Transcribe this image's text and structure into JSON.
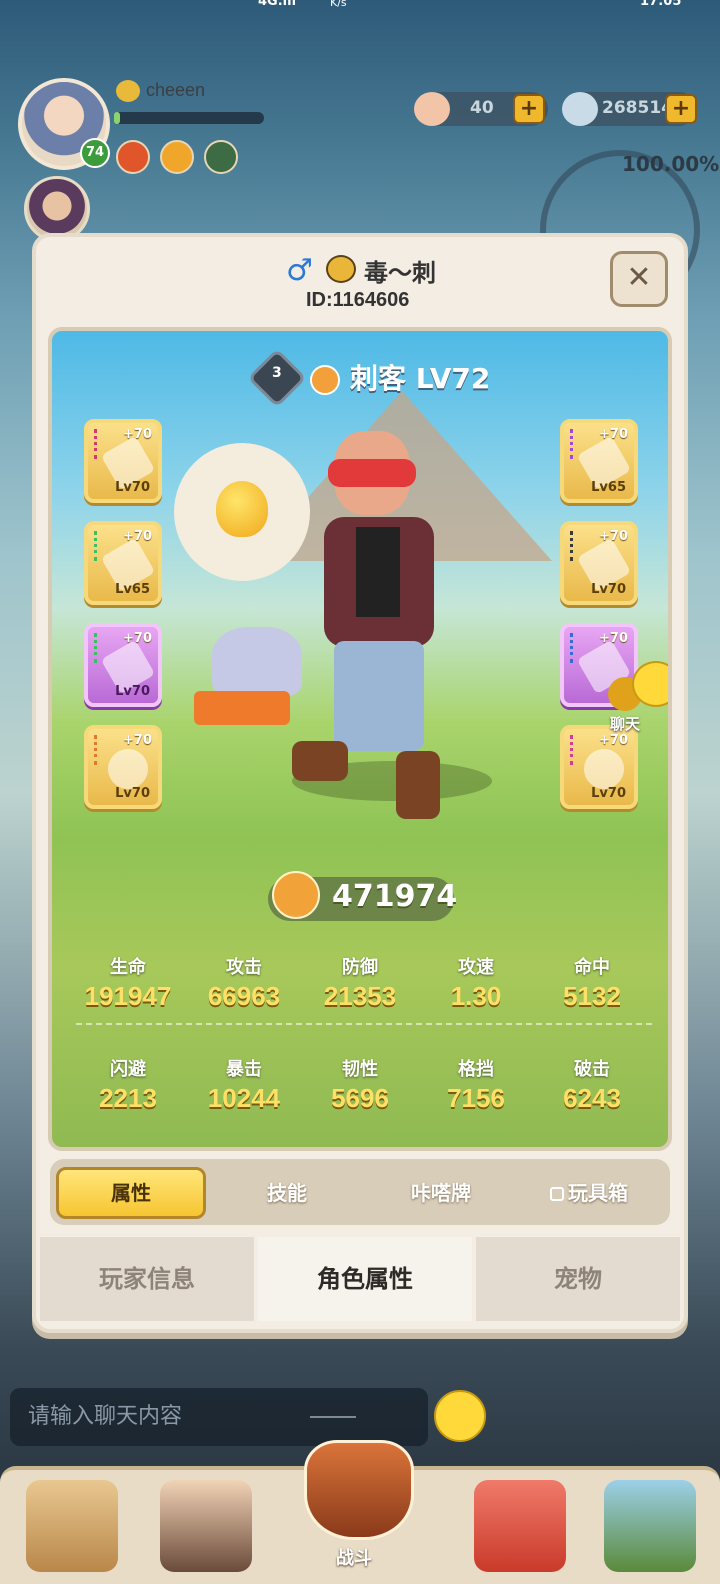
{
  "status_bar": {
    "network": "4G.ıll",
    "speed": "K/s",
    "time": "17:05"
  },
  "hud": {
    "level": "74",
    "username": "cheeen",
    "exp_fraction": 0.04,
    "currency_1": {
      "icon": "shell-icon",
      "value": "40"
    },
    "currency_2": {
      "icon": "gem-icon",
      "value": "268514"
    },
    "percent": "100.00%"
  },
  "panel": {
    "player_name": "毒～刺",
    "player_id": "ID:1164606",
    "gender_icon": "♂",
    "close": "✕",
    "rank": "3",
    "class_title": "刺客 LV72",
    "equipment_left": [
      {
        "plus": "+70",
        "lv": "Lv70",
        "rarity": "gold"
      },
      {
        "plus": "+70",
        "lv": "Lv65",
        "rarity": "gold"
      },
      {
        "plus": "+70",
        "lv": "Lv70",
        "rarity": "purple"
      },
      {
        "plus": "+70",
        "lv": "Lv70",
        "rarity": "gold"
      }
    ],
    "equipment_right": [
      {
        "plus": "+70",
        "lv": "Lv65",
        "rarity": "gold"
      },
      {
        "plus": "+70",
        "lv": "Lv70",
        "rarity": "gold"
      },
      {
        "plus": "+70",
        "lv": "",
        "rarity": "purple"
      },
      {
        "plus": "+70",
        "lv": "Lv70",
        "rarity": "gold"
      }
    ],
    "chat_label": "聊天",
    "power": "471974",
    "stats_row1": [
      {
        "label": "生命",
        "value": "191947"
      },
      {
        "label": "攻击",
        "value": "66963"
      },
      {
        "label": "防御",
        "value": "21353"
      },
      {
        "label": "攻速",
        "value": "1.30"
      },
      {
        "label": "命中",
        "value": "5132"
      }
    ],
    "stats_row2": [
      {
        "label": "闪避",
        "value": "2213"
      },
      {
        "label": "暴击",
        "value": "10244"
      },
      {
        "label": "韧性",
        "value": "5696"
      },
      {
        "label": "格挡",
        "value": "7156"
      },
      {
        "label": "破击",
        "value": "6243"
      }
    ],
    "sub_tabs": [
      "属性",
      "技能",
      "咔嗒牌",
      "玩具箱"
    ],
    "main_tabs": [
      "玩家信息",
      "角色属性",
      "宠物"
    ]
  },
  "chat": {
    "placeholder": "请输入聊天内容"
  },
  "nav": {
    "battle_label": "战斗"
  },
  "colors": {
    "accent": "#f7c531",
    "stat_value": "#ffe066",
    "panel_bg": "#f3ede3"
  }
}
